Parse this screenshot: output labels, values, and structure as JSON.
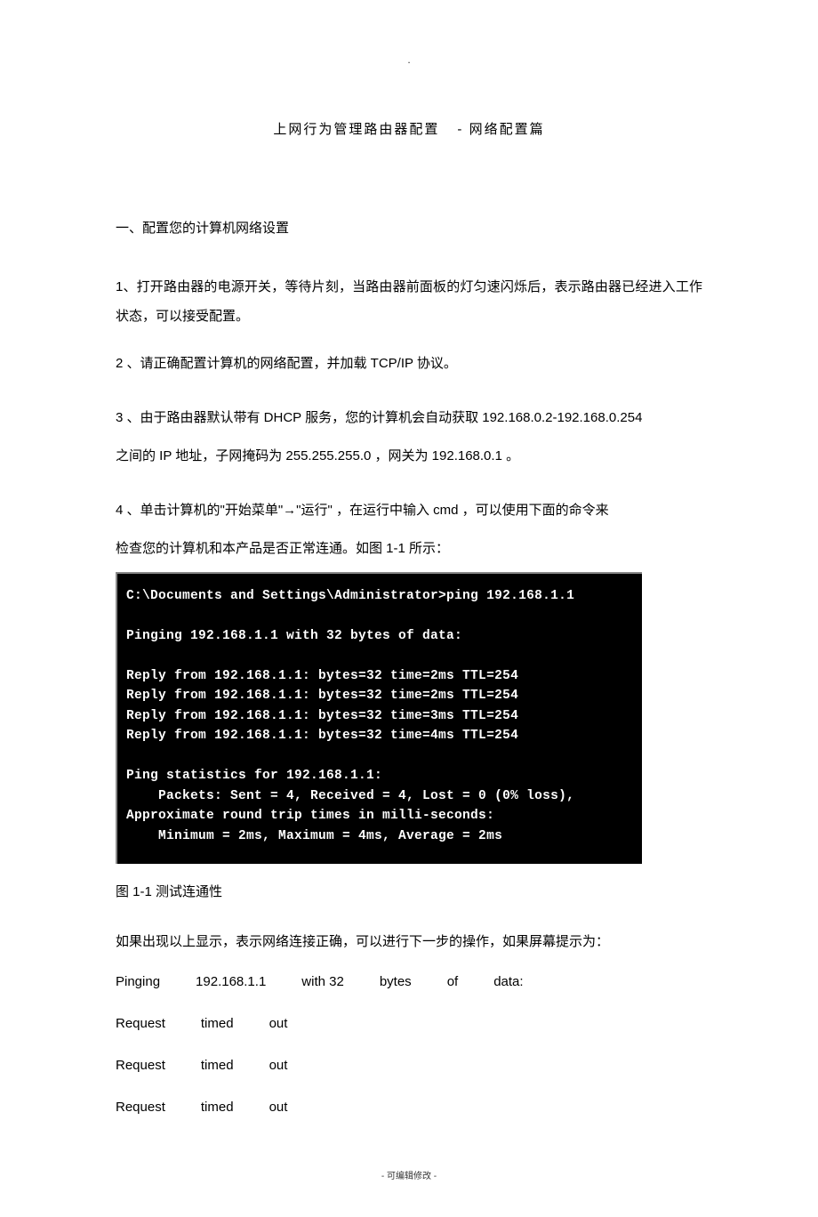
{
  "header_dot": ".",
  "title_part1": "上网行为管理路由器配置",
  "title_part2": "- 网络配置篇",
  "section1_heading": "一、配置您的计算机网络设置",
  "p1": "1、打开路由器的电源开关，等待片刻，当路由器前面板的灯匀速闪烁后，表示路由器已经进入工作状态，可以接受配置。",
  "p2": "2 、请正确配置计算机的网络配置，并加载   TCP/IP 协议。",
  "p3": "3 、由于路由器默认带有  DHCP 服务，您的计算机会自动获取 192.168.0.2-192.168.0.254",
  "p3b": "之间的 IP 地址，子网掩码为  255.255.255.0   ，网关为 192.168.0.1 。",
  "p4": "4 、单击计算机的\"开始菜单\"→\"运行\"   ，在运行中输入   cmd ，可以使用下面的命令来",
  "p4b": "检查您的计算机和本产品是否正常连通。如图     1-1 所示：",
  "terminal_lines": [
    "C:\\Documents and Settings\\Administrator>ping 192.168.1.1",
    "",
    "Pinging 192.168.1.1 with 32 bytes of data:",
    "",
    "Reply from 192.168.1.1: bytes=32 time=2ms TTL=254",
    "Reply from 192.168.1.1: bytes=32 time=2ms TTL=254",
    "Reply from 192.168.1.1: bytes=32 time=3ms TTL=254",
    "Reply from 192.168.1.1: bytes=32 time=4ms TTL=254",
    "",
    "Ping statistics for 192.168.1.1:",
    "    Packets: Sent = 4, Received = 4, Lost = 0 (0% loss),",
    "Approximate round trip times in milli-seconds:",
    "    Minimum = 2ms, Maximum = 4ms, Average = 2ms"
  ],
  "figure_caption": "图  1-1  测试连通性",
  "p5": "如果出现以上显示，表示网络连接正确，可以进行下一步的操作，如果屏幕提示为：",
  "row1": [
    "Pinging",
    "192.168.1.1",
    "with 32",
    "bytes",
    "of",
    "data:"
  ],
  "row2": [
    "Request",
    "timed",
    "out"
  ],
  "row3": [
    "Request",
    "timed",
    "out"
  ],
  "row4": [
    "Request",
    "timed",
    "out"
  ],
  "footer": "- 可编辑修改 -"
}
